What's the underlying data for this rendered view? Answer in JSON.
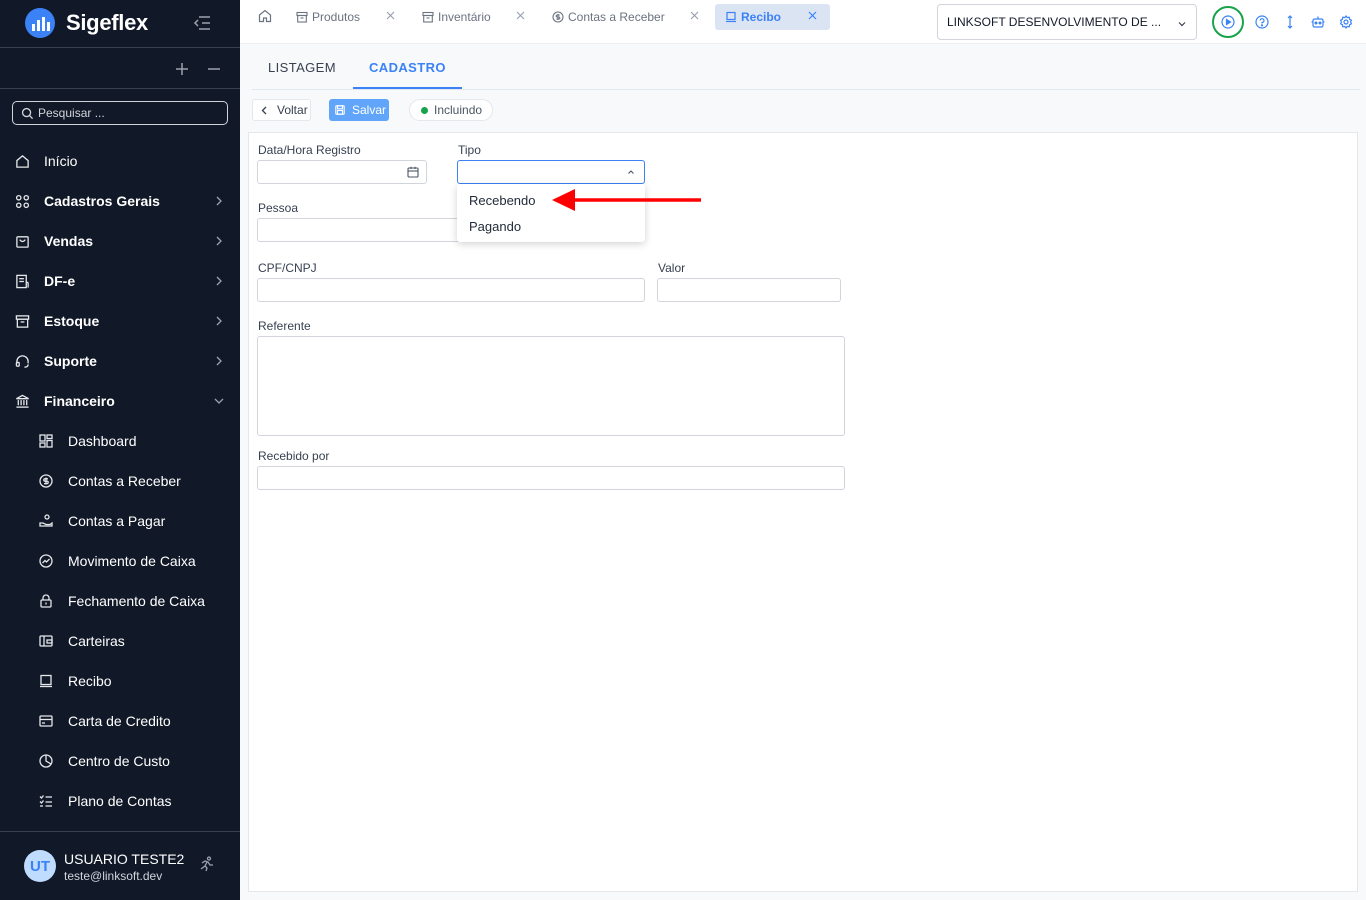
{
  "app": {
    "name": "Sigeflex",
    "colors": {
      "sidebar_bg": "#111827",
      "accent": "#3b82f6",
      "ring": "#16a34a",
      "arrow": "#ff0000"
    }
  },
  "sidebar": {
    "search_placeholder": "Pesquisar ...",
    "items": [
      {
        "label": "Início",
        "icon": "home-icon"
      },
      {
        "label": "Cadastros Gerais",
        "icon": "grid-icon"
      },
      {
        "label": "Vendas",
        "icon": "shopping-bag-icon"
      },
      {
        "label": "DF-e",
        "icon": "document-icon"
      },
      {
        "label": "Estoque",
        "icon": "archive-icon"
      },
      {
        "label": "Suporte",
        "icon": "headset-icon"
      },
      {
        "label": "Financeiro",
        "icon": "bank-icon"
      }
    ],
    "sub_items": [
      {
        "label": "Dashboard",
        "icon": "dashboard-icon"
      },
      {
        "label": "Contas a Receber",
        "icon": "dollar-circle-icon"
      },
      {
        "label": "Contas a Pagar",
        "icon": "hand-coins-icon"
      },
      {
        "label": "Movimento de Caixa",
        "icon": "trend-icon"
      },
      {
        "label": "Fechamento de Caixa",
        "icon": "lock-icon"
      },
      {
        "label": "Carteiras",
        "icon": "wallet-icon"
      },
      {
        "label": "Recibo",
        "icon": "receipt-icon"
      },
      {
        "label": "Carta de Credito",
        "icon": "card-icon"
      },
      {
        "label": "Centro de Custo",
        "icon": "pie-icon"
      },
      {
        "label": "Plano de Contas",
        "icon": "list-check-icon"
      }
    ],
    "user": {
      "initials": "UT",
      "name": "USUARIO TESTE2",
      "email": "teste@linksoft.dev"
    }
  },
  "topbar": {
    "tabs": [
      {
        "label": "Produtos",
        "icon": "box-icon"
      },
      {
        "label": "Inventário",
        "icon": "box-icon"
      },
      {
        "label": "Contas a Receber",
        "icon": "dollar-circle-icon"
      },
      {
        "label": "Recibo",
        "icon": "receipt-icon"
      }
    ],
    "company": "LINKSOFT DESENVOLVIMENTO DE ..."
  },
  "content": {
    "tabs": {
      "list": "LISTAGEM",
      "form": "CADASTRO"
    },
    "actions": {
      "back": "Voltar",
      "save": "Salvar",
      "status": "Incluindo"
    },
    "form": {
      "data_hora": "Data/Hora Registro",
      "tipo": "Tipo",
      "pessoa": "Pessoa",
      "cpf_cnpj": "CPF/CNPJ",
      "valor": "Valor",
      "referente": "Referente",
      "recebido_por": "Recebido por"
    },
    "tipo_options": [
      "Recebendo",
      "Pagando"
    ]
  }
}
